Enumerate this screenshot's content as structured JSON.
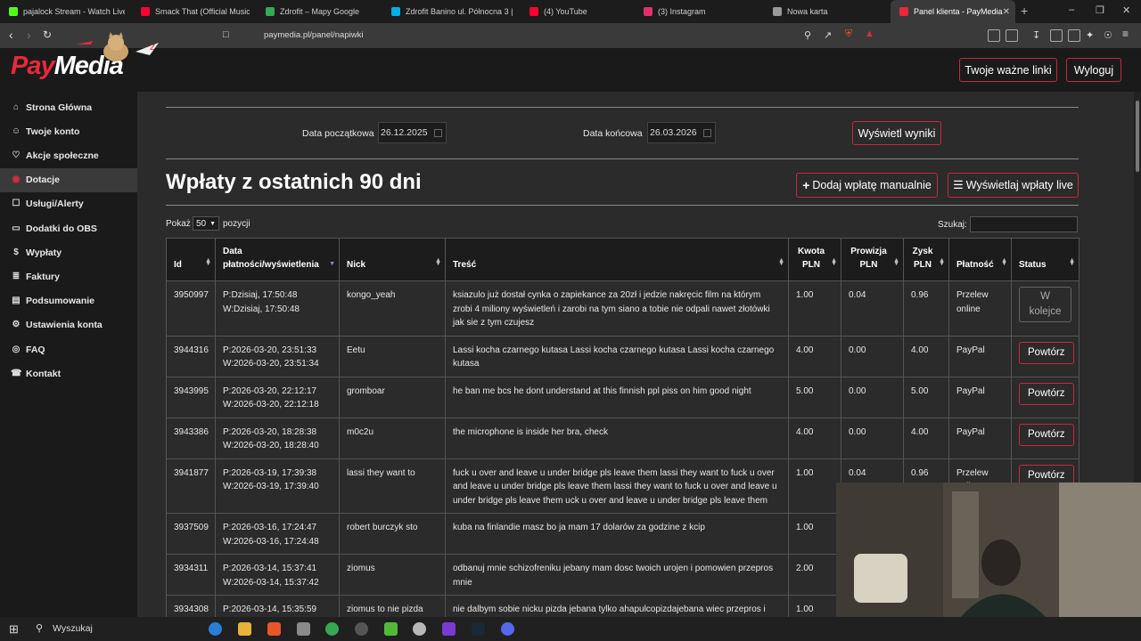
{
  "browser": {
    "tabs": [
      {
        "label": "pajalock Stream - Watch Live o",
        "color": "#53fc18"
      },
      {
        "label": "Smack That (Official Music",
        "color": "#ff0033"
      },
      {
        "label": "Zdrofit – Mapy Google",
        "color": "#34a853"
      },
      {
        "label": "Zdrofit Banino ul. Północna 3 |",
        "color": "#00b1e5"
      },
      {
        "label": "(4) YouTube",
        "color": "#ff0033"
      },
      {
        "label": "(3) Instagram",
        "color": "#e1306c"
      },
      {
        "label": "Nowa karta",
        "color": "#999999"
      },
      {
        "label": "Panel klienta - PayMedia",
        "color": "#e8283c"
      }
    ],
    "url": "paymedia.pl/panel/napiwki"
  },
  "header": {
    "logo_pay": "Pay",
    "logo_media": "Media",
    "links_label": "Twoje ważne linki",
    "logout_label": "Wyloguj"
  },
  "sidebar": {
    "items": [
      {
        "label": "Strona Główna",
        "icon": "home-icon"
      },
      {
        "label": "Twoje konto",
        "icon": "user-icon"
      },
      {
        "label": "Akcje społeczne",
        "icon": "heart-icon"
      },
      {
        "label": "Dotacje",
        "icon": "donate-icon",
        "active": true
      },
      {
        "label": "Usługi/Alerty",
        "icon": "cart-icon"
      },
      {
        "label": "Dodatki do OBS",
        "icon": "desktop-icon"
      },
      {
        "label": "Wypłaty",
        "icon": "dollar-icon"
      },
      {
        "label": "Faktury",
        "icon": "invoice-icon"
      },
      {
        "label": "Podsumowanie",
        "icon": "summary-icon"
      },
      {
        "label": "Ustawienia konta",
        "icon": "gear-icon"
      },
      {
        "label": "FAQ",
        "icon": "faq-icon"
      },
      {
        "label": "Kontakt",
        "icon": "phone-icon"
      }
    ]
  },
  "filters": {
    "start_label": "Data początkowa",
    "start_value": "26.12.2025",
    "end_label": "Data końcowa",
    "end_value": "26.03.2026",
    "show_label": "Wyświetl wyniki"
  },
  "main": {
    "title": "Wpłaty z ostatnich 90 dni",
    "add_manual_label": "Dodaj wpłatę manualnie",
    "show_live_label": "Wyświetlaj wpłaty live",
    "show_prefix": "Pokaż",
    "page_size": "50",
    "show_suffix": "pozycji",
    "search_label": "Szukaj:"
  },
  "table": {
    "headers": [
      "Id",
      "Data płatności/wyświetlenia",
      "Nick",
      "Treść",
      "Kwota PLN",
      "Prowizja PLN",
      "Zysk PLN",
      "Płatność",
      "Status"
    ],
    "rows": [
      {
        "id": "3950997",
        "paid": "P:Dzisiaj, 17:50:48",
        "shown": "W:Dzisiaj, 17:50:48",
        "nick": "kongo_yeah",
        "text": "ksiazulo już dostał cynka o zapiekance za 20zł i jedzie nakręcic film na którym zrobi 4 miliony wyświetleń i zarobi na tym siano a tobie nie odpali nawet złotówki jak sie z tym czujesz",
        "amount": "1.00",
        "fee": "0.04",
        "profit": "0.96",
        "payment": "Przelew online",
        "status": "W kolejce",
        "status_type": "queue"
      },
      {
        "id": "3944316",
        "paid": "P:2026-03-20, 23:51:33",
        "shown": "W:2026-03-20, 23:51:34",
        "nick": "Eetu",
        "text": "Lassi kocha czarnego kutasa Lassi kocha czarnego kutasa Lassi kocha czarnego kutasa",
        "amount": "4.00",
        "fee": "0.00",
        "profit": "4.00",
        "payment": "PayPal",
        "status": "Powtórz",
        "status_type": "repeat"
      },
      {
        "id": "3943995",
        "paid": "P:2026-03-20, 22:12:17",
        "shown": "W:2026-03-20, 22:12:18",
        "nick": "gromboar",
        "text": "he ban me bcs he dont understand at this finnish ppl piss on him good night",
        "amount": "5.00",
        "fee": "0.00",
        "profit": "5.00",
        "payment": "PayPal",
        "status": "Powtórz",
        "status_type": "repeat"
      },
      {
        "id": "3943386",
        "paid": "P:2026-03-20, 18:28:38",
        "shown": "W:2026-03-20, 18:28:40",
        "nick": "m0c2u",
        "text": "the microphone is inside her bra, check",
        "amount": "4.00",
        "fee": "0.00",
        "profit": "4.00",
        "payment": "PayPal",
        "status": "Powtórz",
        "status_type": "repeat"
      },
      {
        "id": "3941877",
        "paid": "P:2026-03-19, 17:39:38",
        "shown": "W:2026-03-19, 17:39:40",
        "nick": "lassi they want to",
        "text": "fuck u over and leave u under bridge pls leave them lassi they want to fuck u over and leave u under bridge pls leave them lassi they want to fuck u over and leave u under bridge pls leave them uck u over and leave u under bridge pls leave them",
        "amount": "1.00",
        "fee": "0.04",
        "profit": "0.96",
        "payment": "Przelew online",
        "status": "Powtórz",
        "status_type": "repeat"
      },
      {
        "id": "3937509",
        "paid": "P:2026-03-16, 17:24:47",
        "shown": "W:2026-03-16, 17:24:48",
        "nick": "robert burczyk sto",
        "text": "kuba na finlandie masz bo ja mam 17 dolarów za godzine z kcip",
        "amount": "1.00",
        "fee": "",
        "profit": "",
        "payment": "",
        "status": "",
        "status_type": "none"
      },
      {
        "id": "3934311",
        "paid": "P:2026-03-14, 15:37:41",
        "shown": "W:2026-03-14, 15:37:42",
        "nick": "ziomus",
        "text": "odbanuj mnie schizofreniku jebany mam dosc twoich urojen i pomowien przepros mnie",
        "amount": "2.00",
        "fee": "",
        "profit": "",
        "payment": "",
        "status": "",
        "status_type": "none"
      },
      {
        "id": "3934308",
        "paid": "P:2026-03-14, 15:35:59",
        "shown": "",
        "nick": "ziomus to nie pizda",
        "text": "nie dalbym sobie nicku pizda jebana tylko ahapulcopizdajebana wiec przepros i",
        "amount": "1.00",
        "fee": "",
        "profit": "",
        "payment": "",
        "status": "",
        "status_type": "none"
      }
    ]
  },
  "taskbar": {
    "search_label": "Wyszukaj"
  }
}
